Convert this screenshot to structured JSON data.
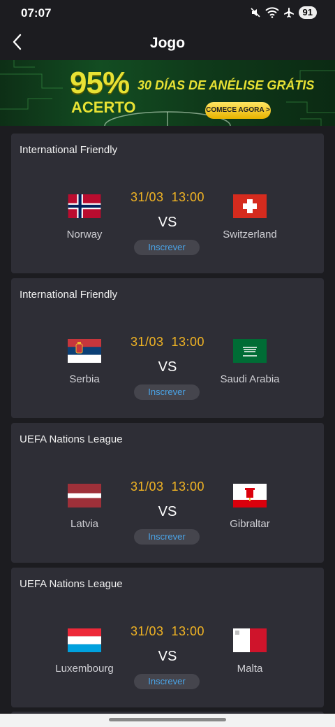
{
  "status": {
    "time": "07:07",
    "battery": "91"
  },
  "header": {
    "title": "Jogo"
  },
  "banner": {
    "percent": "95%",
    "percent_label": "ACERTO",
    "headline": "30 DÍAS DE ANÉLISE GRÁTIS",
    "cta": "COMECE AGORA >"
  },
  "matches": [
    {
      "competition": "International Friendly",
      "date": "31/03",
      "time": "13:00",
      "vs": "VS",
      "home": "Norway",
      "away": "Switzerland",
      "subscribe": "Inscrever"
    },
    {
      "competition": "International Friendly",
      "date": "31/03",
      "time": "13:00",
      "vs": "VS",
      "home": "Serbia",
      "away": "Saudi Arabia",
      "subscribe": "Inscrever"
    },
    {
      "competition": "UEFA Nations League",
      "date": "31/03",
      "time": "13:00",
      "vs": "VS",
      "home": "Latvia",
      "away": "Gibraltar",
      "subscribe": "Inscrever"
    },
    {
      "competition": "UEFA Nations League",
      "date": "31/03",
      "time": "13:00",
      "vs": "VS",
      "home": "Luxembourg",
      "away": "Malta",
      "subscribe": "Inscrever"
    }
  ],
  "colors": {
    "background": "#1c1c20",
    "card": "#2e2e36",
    "datetime": "#f0b324",
    "subscribe_text": "#4aa3e6",
    "banner_accent": "#e8e234"
  },
  "icons": [
    "mute-icon",
    "wifi-icon",
    "airplane-icon",
    "back-arrow-icon"
  ]
}
